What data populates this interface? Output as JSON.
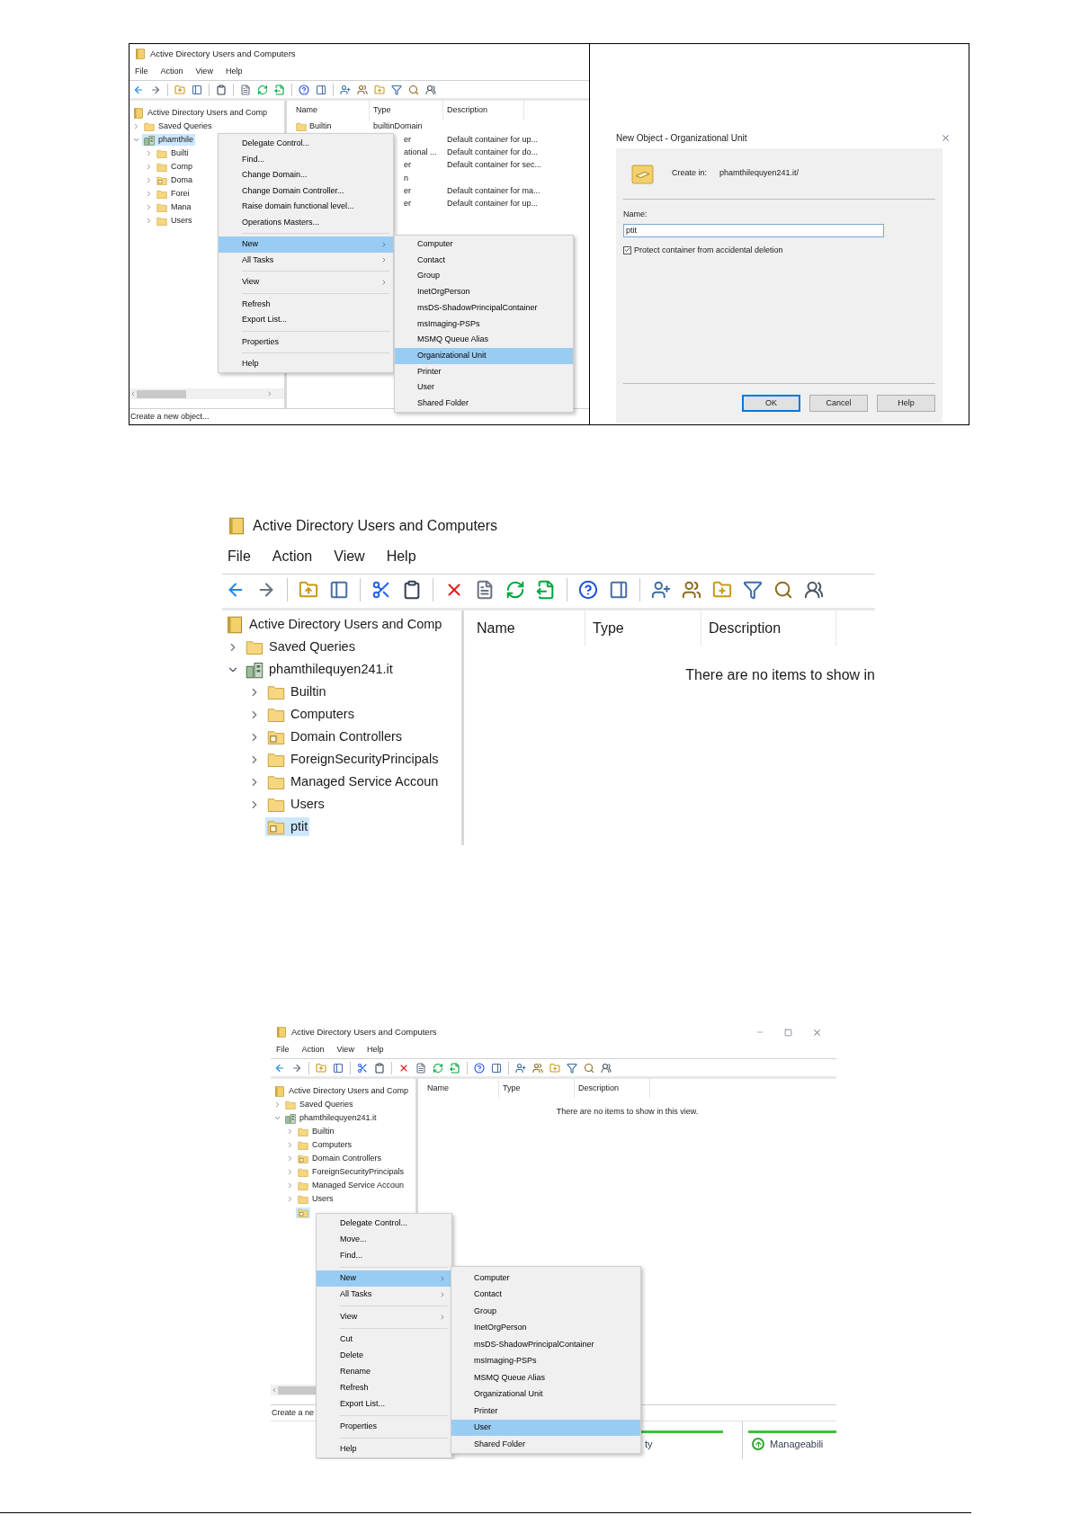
{
  "figure_1": {
    "window": {
      "title": "Active Directory Users and Computers",
      "menu": [
        "File",
        "Action",
        "View",
        "Help"
      ],
      "tree": [
        {
          "label": "Active Directory Users and Comp",
          "kind": "console",
          "selected": false,
          "children": [
            {
              "label": "Saved Queries",
              "kind": "folder",
              "expanded": false,
              "selected": false
            },
            {
              "label": "phamthile",
              "kind": "domain",
              "expanded": true,
              "selected": true,
              "children": [
                {
                  "label": "Builti",
                  "kind": "folder",
                  "expanded": false,
                  "selected": false
                },
                {
                  "label": "Comp",
                  "kind": "folder",
                  "expanded": false,
                  "selected": false
                },
                {
                  "label": "Doma",
                  "kind": "ou",
                  "expanded": false,
                  "selected": false
                },
                {
                  "label": "Forei",
                  "kind": "folder",
                  "expanded": false,
                  "selected": false
                },
                {
                  "label": "Mana",
                  "kind": "folder",
                  "expanded": false,
                  "selected": false
                },
                {
                  "label": "Users",
                  "kind": "folder",
                  "expanded": false,
                  "selected": false
                }
              ]
            }
          ]
        }
      ],
      "columns": [
        "Name",
        "Type",
        "Description"
      ],
      "rows": [
        {
          "name": "Builtin",
          "type": "builtinDomain"
        },
        {
          "type": "er",
          "description": "Default container for up..."
        },
        {
          "type": "ational ...",
          "description": "Default container for do..."
        },
        {
          "type": "er",
          "description": "Default container for sec..."
        },
        {
          "type": "n"
        },
        {
          "type": "er",
          "description": "Default container for ma..."
        },
        {
          "type": "er",
          "description": "Default container for up..."
        }
      ],
      "context_menu": [
        {
          "kind": "item",
          "label": "Delegate Control...",
          "submenu": false,
          "selected": false
        },
        {
          "kind": "item",
          "label": "Find...",
          "submenu": false,
          "selected": false
        },
        {
          "kind": "item",
          "label": "Change Domain...",
          "submenu": false,
          "selected": false
        },
        {
          "kind": "item",
          "label": "Change Domain Controller...",
          "submenu": false,
          "selected": false
        },
        {
          "kind": "item",
          "label": "Raise domain functional level...",
          "submenu": false,
          "selected": false
        },
        {
          "kind": "item",
          "label": "Operations Masters...",
          "submenu": false,
          "selected": false
        },
        {
          "kind": "separator"
        },
        {
          "kind": "item",
          "label": "New",
          "submenu": true,
          "selected": true
        },
        {
          "kind": "item",
          "label": "All Tasks",
          "submenu": true,
          "selected": false
        },
        {
          "kind": "separator"
        },
        {
          "kind": "item",
          "label": "View",
          "submenu": true,
          "selected": false
        },
        {
          "kind": "separator"
        },
        {
          "kind": "item",
          "label": "Refresh",
          "submenu": false,
          "selected": false
        },
        {
          "kind": "item",
          "label": "Export List...",
          "submenu": false,
          "selected": false
        },
        {
          "kind": "separator"
        },
        {
          "kind": "item",
          "label": "Properties",
          "submenu": false,
          "selected": false
        },
        {
          "kind": "separator"
        },
        {
          "kind": "item",
          "label": "Help",
          "submenu": false,
          "selected": false
        }
      ],
      "submenu": [
        {
          "kind": "item",
          "label": "Computer",
          "submenu": false,
          "selected": false
        },
        {
          "kind": "item",
          "label": "Contact",
          "submenu": false,
          "selected": false
        },
        {
          "kind": "item",
          "label": "Group",
          "submenu": false,
          "selected": false
        },
        {
          "kind": "item",
          "label": "InetOrgPerson",
          "submenu": false,
          "selected": false
        },
        {
          "kind": "item",
          "label": "msDS-ShadowPrincipalContainer",
          "submenu": false,
          "selected": false
        },
        {
          "kind": "item",
          "label": "msImaging-PSPs",
          "submenu": false,
          "selected": false
        },
        {
          "kind": "item",
          "label": "MSMQ Queue Alias",
          "submenu": false,
          "selected": false
        },
        {
          "kind": "item",
          "label": "Organizational Unit",
          "submenu": false,
          "selected": true
        },
        {
          "kind": "item",
          "label": "Printer",
          "submenu": false,
          "selected": false
        },
        {
          "kind": "item",
          "label": "User",
          "submenu": false,
          "selected": false
        },
        {
          "kind": "item",
          "label": "Shared Folder",
          "submenu": false,
          "selected": false
        }
      ],
      "status_bar": "Create a new object..."
    },
    "dialog": {
      "title": "New Object - Organizational Unit",
      "create_in_label": "Create in:",
      "create_in_value": "phamthilequyen241.it/",
      "name_label": "Name:",
      "name_value": "ptit",
      "protect": {
        "label": "Protect container from accidental deletion",
        "checked": true
      },
      "buttons": [
        {
          "label": "OK",
          "default": true
        },
        {
          "label": "Cancel",
          "default": false
        },
        {
          "label": "Help",
          "default": false
        }
      ]
    }
  },
  "figure_2": {
    "window": {
      "title": "Active Directory Users and Computers",
      "menu": [
        "File",
        "Action",
        "View",
        "Help"
      ],
      "tree": [
        {
          "label": "Active Directory Users and Comp",
          "kind": "console",
          "selected": false,
          "children": [
            {
              "label": "Saved Queries",
              "kind": "folder",
              "expanded": false,
              "selected": false
            },
            {
              "label": "phamthilequyen241.it",
              "kind": "domain",
              "expanded": true,
              "selected": false,
              "children": [
                {
                  "label": "Builtin",
                  "kind": "folder",
                  "expanded": false,
                  "selected": false
                },
                {
                  "label": "Computers",
                  "kind": "folder",
                  "expanded": false,
                  "selected": false
                },
                {
                  "label": "Domain Controllers",
                  "kind": "ou",
                  "expanded": false,
                  "selected": false
                },
                {
                  "label": "ForeignSecurityPrincipals",
                  "kind": "folder",
                  "expanded": false,
                  "selected": false
                },
                {
                  "label": "Managed Service Accoun",
                  "kind": "folder",
                  "expanded": false,
                  "selected": false
                },
                {
                  "label": "Users",
                  "kind": "folder",
                  "expanded": false,
                  "selected": false
                },
                {
                  "label": "ptit",
                  "kind": "ou",
                  "selected": true
                }
              ]
            }
          ]
        }
      ],
      "columns": [
        "Name",
        "Type",
        "Description"
      ],
      "empty_message": "There are no items to show in"
    }
  },
  "figure_3": {
    "window": {
      "title": "Active Directory Users and Computers",
      "menu": [
        "File",
        "Action",
        "View",
        "Help"
      ],
      "tree": [
        {
          "label": "Active Directory Users and Comp",
          "kind": "console",
          "selected": false,
          "children": [
            {
              "label": "Saved Queries",
              "kind": "folder",
              "expanded": false,
              "selected": false
            },
            {
              "label": "phamthilequyen241.it",
              "kind": "domain",
              "expanded": true,
              "selected": false,
              "children": [
                {
                  "label": "Builtin",
                  "kind": "folder",
                  "expanded": false,
                  "selected": false
                },
                {
                  "label": "Computers",
                  "kind": "folder",
                  "expanded": false,
                  "selected": false
                },
                {
                  "label": "Domain Controllers",
                  "kind": "ou",
                  "expanded": false,
                  "selected": false
                },
                {
                  "label": "ForeignSecurityPrincipals",
                  "kind": "folder",
                  "expanded": false,
                  "selected": false
                },
                {
                  "label": "Managed Service Accoun",
                  "kind": "folder",
                  "expanded": false,
                  "selected": false
                },
                {
                  "label": "Users",
                  "kind": "folder",
                  "expanded": false,
                  "selected": false
                },
                {
                  "kind": "ou",
                  "selected": true
                }
              ]
            }
          ]
        }
      ],
      "columns": [
        "Name",
        "Type",
        "Description"
      ],
      "empty_message": "There are no items to show in this view.",
      "context_menu": [
        {
          "kind": "item",
          "label": "Delegate Control...",
          "submenu": false,
          "selected": false
        },
        {
          "kind": "item",
          "label": "Move...",
          "submenu": false,
          "selected": false
        },
        {
          "kind": "item",
          "label": "Find...",
          "submenu": false,
          "selected": false
        },
        {
          "kind": "separator"
        },
        {
          "kind": "item",
          "label": "New",
          "submenu": true,
          "selected": true
        },
        {
          "kind": "item",
          "label": "All Tasks",
          "submenu": true,
          "selected": false
        },
        {
          "kind": "separator"
        },
        {
          "kind": "item",
          "label": "View",
          "submenu": true,
          "selected": false
        },
        {
          "kind": "separator"
        },
        {
          "kind": "item",
          "label": "Cut",
          "submenu": false,
          "selected": false
        },
        {
          "kind": "item",
          "label": "Delete",
          "submenu": false,
          "selected": false
        },
        {
          "kind": "item",
          "label": "Rename",
          "submenu": false,
          "selected": false
        },
        {
          "kind": "item",
          "label": "Refresh",
          "submenu": false,
          "selected": false
        },
        {
          "kind": "item",
          "label": "Export List...",
          "submenu": false,
          "selected": false
        },
        {
          "kind": "separator"
        },
        {
          "kind": "item",
          "label": "Properties",
          "submenu": false,
          "selected": false
        },
        {
          "kind": "separator"
        },
        {
          "kind": "item",
          "label": "Help",
          "submenu": false,
          "selected": false
        }
      ],
      "submenu": [
        {
          "kind": "item",
          "label": "Computer",
          "submenu": false,
          "selected": false
        },
        {
          "kind": "item",
          "label": "Contact",
          "submenu": false,
          "selected": false
        },
        {
          "kind": "item",
          "label": "Group",
          "submenu": false,
          "selected": false
        },
        {
          "kind": "item",
          "label": "InetOrgPerson",
          "submenu": false,
          "selected": false
        },
        {
          "kind": "item",
          "label": "msDS-ShadowPrincipalContainer",
          "submenu": false,
          "selected": false
        },
        {
          "kind": "item",
          "label": "msImaging-PSPs",
          "submenu": false,
          "selected": false
        },
        {
          "kind": "item",
          "label": "MSMQ Queue Alias",
          "submenu": false,
          "selected": false
        },
        {
          "kind": "item",
          "label": "Organizational Unit",
          "submenu": false,
          "selected": false
        },
        {
          "kind": "item",
          "label": "Printer",
          "submenu": false,
          "selected": false
        },
        {
          "kind": "item",
          "label": "User",
          "submenu": false,
          "selected": true
        },
        {
          "kind": "item",
          "label": "Shared Folder",
          "submenu": false,
          "selected": false
        }
      ],
      "status_bar": "Create a ne",
      "background_window": {
        "tile_text": "ty",
        "item": "Manageabili"
      }
    }
  }
}
